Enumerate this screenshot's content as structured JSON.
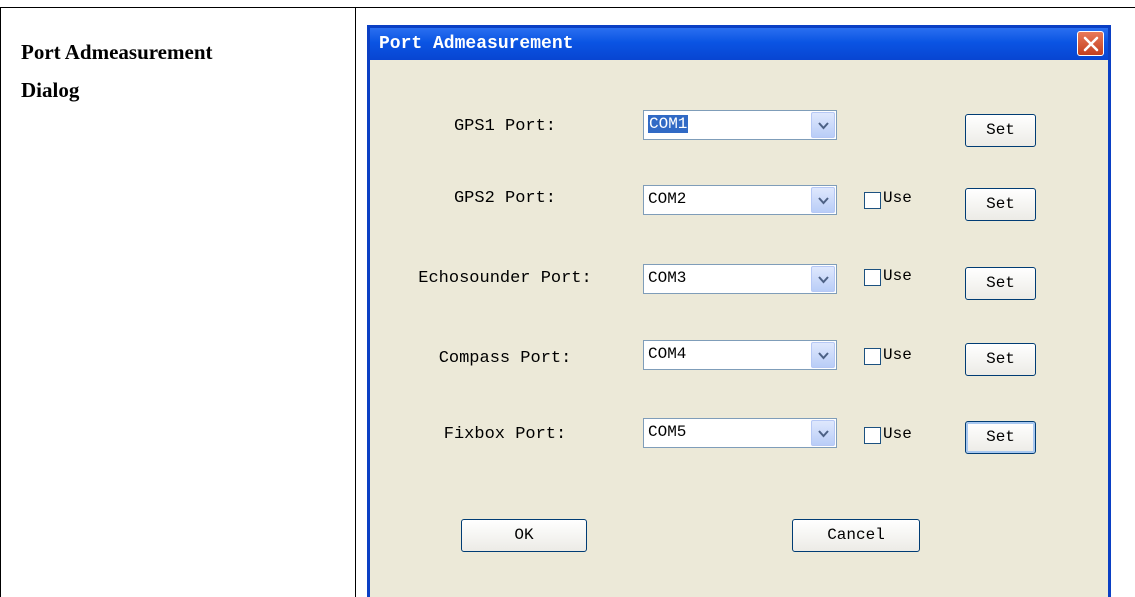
{
  "document": {
    "label_line1": "Port Admeasurement",
    "label_line2": "Dialog"
  },
  "dialog": {
    "title": "Port Admeasurement",
    "rows": [
      {
        "label": "GPS1 Port:",
        "value": "COM1",
        "has_use": false,
        "use_label": "",
        "set_label": "Set"
      },
      {
        "label": "GPS2 Port:",
        "value": "COM2",
        "has_use": true,
        "use_label": "Use",
        "set_label": "Set"
      },
      {
        "label": "Echosounder Port:",
        "value": "COM3",
        "has_use": true,
        "use_label": "Use",
        "set_label": "Set"
      },
      {
        "label": "Compass Port:",
        "value": "COM4",
        "has_use": true,
        "use_label": "Use",
        "set_label": "Set"
      },
      {
        "label": "Fixbox Port:",
        "value": "COM5",
        "has_use": true,
        "use_label": "Use",
        "set_label": "Set"
      }
    ],
    "ok_label": "OK",
    "cancel_label": "Cancel"
  }
}
